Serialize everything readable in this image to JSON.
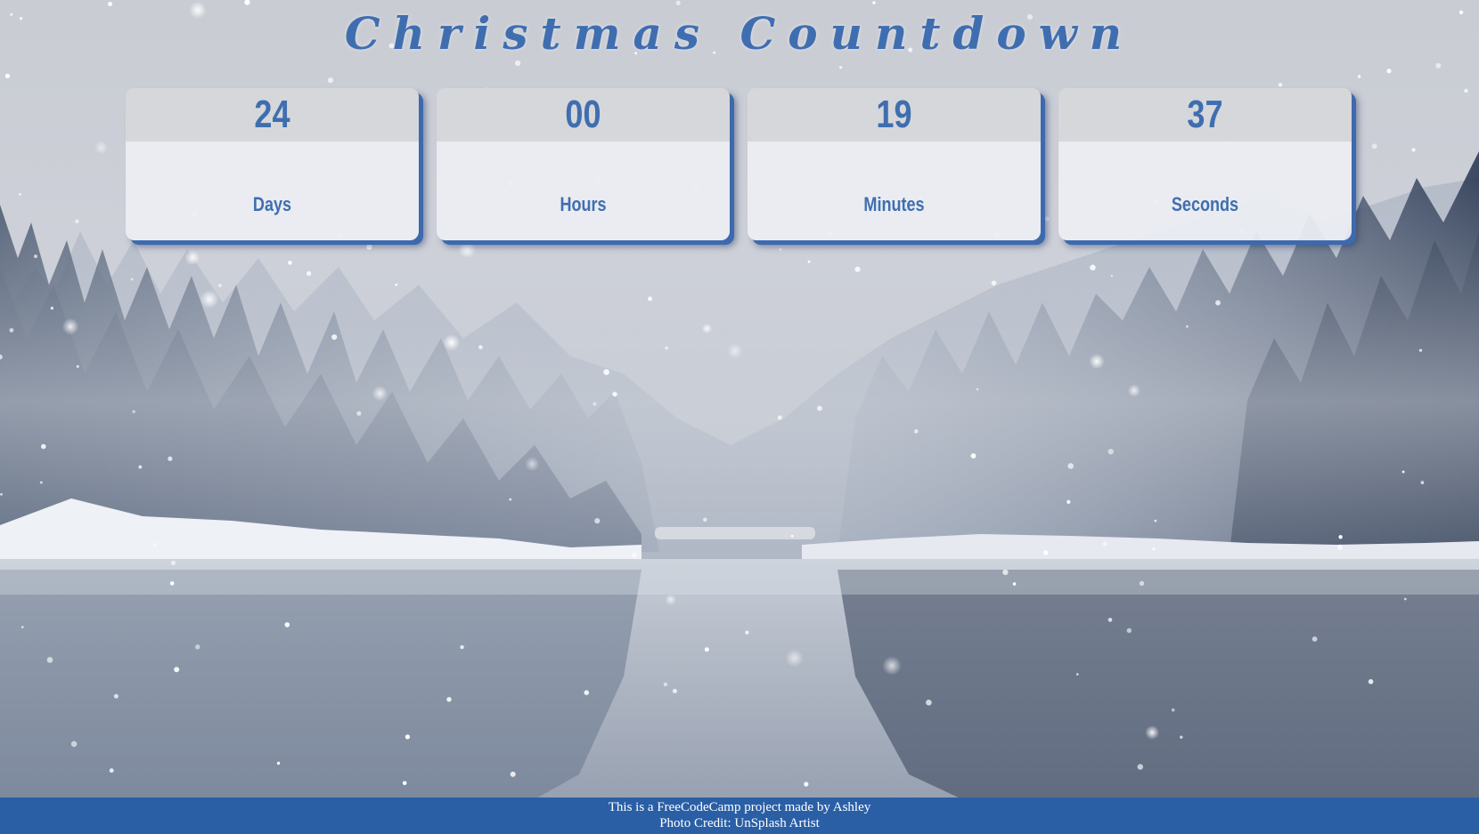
{
  "page": {
    "title": "Christmas Countdown"
  },
  "countdown": [
    {
      "value": "24",
      "unit": "Days"
    },
    {
      "value": "00",
      "unit": "Hours"
    },
    {
      "value": "19",
      "unit": "Minutes"
    },
    {
      "value": "37",
      "unit": "Seconds"
    }
  ],
  "footer": {
    "line1": "This is a FreeCodeCamp project made by Ashley",
    "line2": "Photo Credit: UnSplash Artist"
  },
  "colors": {
    "accent": "#3f6eb0",
    "footer_bg": "#2a5fa6",
    "card_band": "#d6d7da"
  },
  "background": {
    "scene": "snowy-lake-forest-photo"
  }
}
